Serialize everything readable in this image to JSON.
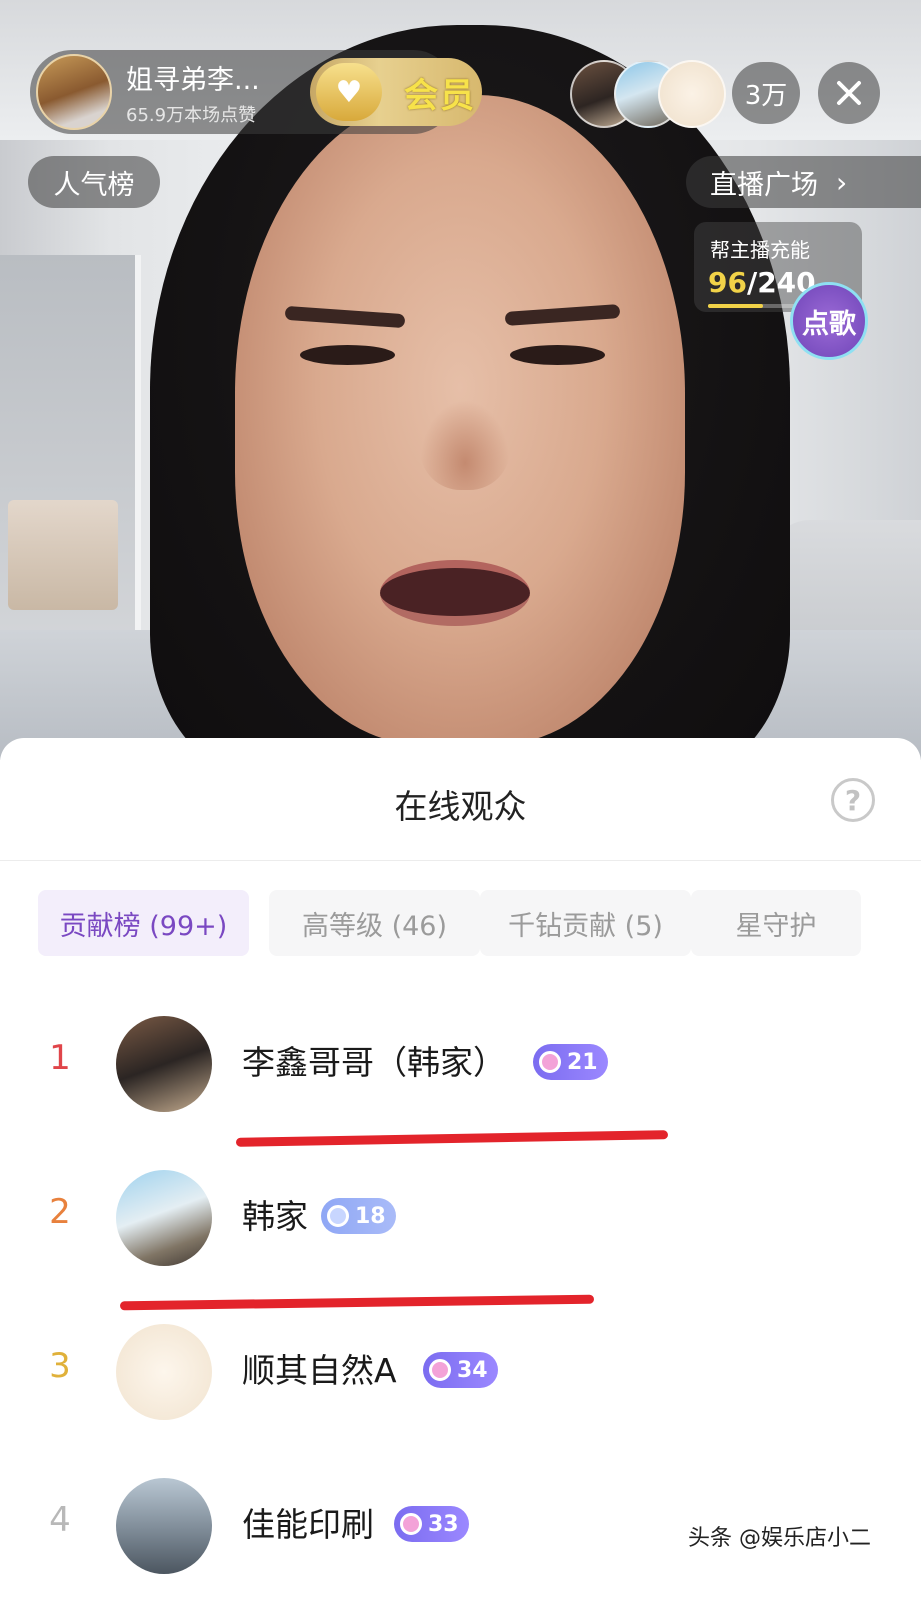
{
  "header": {
    "host_name": "姐寻弟李...",
    "host_likes": "65.9万本场点赞",
    "vip_label": "会员",
    "viewer_count": "3万",
    "popularity_label": "人气榜",
    "plaza_label": "直播广场",
    "charge": {
      "title": "帮主播充能",
      "current": "96",
      "total": "/240",
      "progress": 0.4
    },
    "song_label": "点歌"
  },
  "sheet": {
    "title": "在线观众",
    "tabs": [
      {
        "label": "贡献榜 (99+)",
        "active": true
      },
      {
        "label": "高等级 (46)",
        "active": false
      },
      {
        "label": "千钻贡献 (5)",
        "active": false
      },
      {
        "label": "星守护",
        "active": false
      }
    ],
    "viewers": [
      {
        "rank": "1",
        "name": "李鑫哥哥（韩家）",
        "level": "21",
        "rank_color": "#e0454a"
      },
      {
        "rank": "2",
        "name": "韩家",
        "level": "18",
        "rank_color": "#e8813d"
      },
      {
        "rank": "3",
        "name": "顺其自然A",
        "level": "34",
        "rank_color": "#e0b13a"
      },
      {
        "rank": "4",
        "name": "佳能印刷",
        "level": "33",
        "rank_color": "#b8b8b8"
      }
    ]
  },
  "watermark": "头条 @娱乐店小二",
  "colors": {
    "accent": "#7a48c2",
    "annotation": "#e3242b",
    "vip_gold": "#f7e24a"
  }
}
